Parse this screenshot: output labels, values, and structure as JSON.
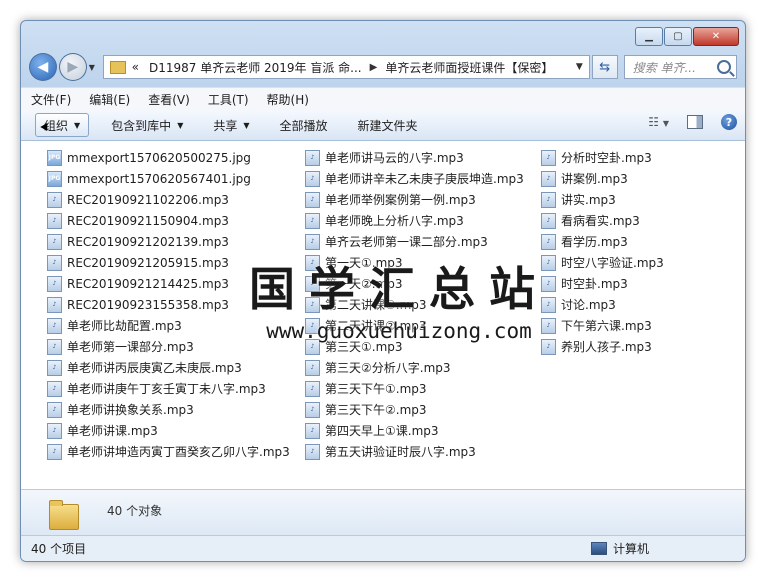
{
  "window": {
    "caption_buttons": [
      "▁",
      "▢",
      "✕"
    ]
  },
  "nav": {
    "back_icon": "back-arrow-icon",
    "forward_icon": "forward-arrow-icon",
    "breadcrumb_prefix": "«",
    "breadcrumb": [
      "D11987 单齐云老师 2019年 盲派 命...",
      "单齐云老师面授班课件【保密】"
    ],
    "search_placeholder": "搜索 单齐..."
  },
  "menu": [
    "文件(F)",
    "编辑(E)",
    "查看(V)",
    "工具(T)",
    "帮助(H)"
  ],
  "toolbar": {
    "organize": "组织",
    "include_library": "包含到库中",
    "share": "共享",
    "play_all": "全部播放",
    "new_folder": "新建文件夹"
  },
  "files": {
    "col1": [
      {
        "name": "mmexport1570620500275.jpg",
        "type": "jpg"
      },
      {
        "name": "mmexport1570620567401.jpg",
        "type": "jpg"
      },
      {
        "name": "REC20190921102206.mp3",
        "type": "mp3"
      },
      {
        "name": "REC20190921150904.mp3",
        "type": "mp3"
      },
      {
        "name": "REC20190921202139.mp3",
        "type": "mp3"
      },
      {
        "name": "REC20190921205915.mp3",
        "type": "mp3"
      },
      {
        "name": "REC20190921214425.mp3",
        "type": "mp3"
      },
      {
        "name": "REC20190923155358.mp3",
        "type": "mp3"
      },
      {
        "name": "单老师比劫配置.mp3",
        "type": "mp3"
      },
      {
        "name": "单老师第一课部分.mp3",
        "type": "mp3"
      },
      {
        "name": "单老师讲丙辰庚寅乙未庚辰.mp3",
        "type": "mp3"
      },
      {
        "name": "单老师讲庚午丁亥壬寅丁未八字.mp3",
        "type": "mp3"
      },
      {
        "name": "单老师讲换象关系.mp3",
        "type": "mp3"
      },
      {
        "name": "单老师讲课.mp3",
        "type": "mp3"
      },
      {
        "name": "单老师讲坤造丙寅丁酉癸亥乙卯八字.mp3",
        "type": "mp3"
      }
    ],
    "col2": [
      {
        "name": "单老师讲马云的八字.mp3",
        "type": "mp3"
      },
      {
        "name": "单老师讲辛未乙未庚子庚辰坤造.mp3",
        "type": "mp3"
      },
      {
        "name": "单老师举例案例第一例.mp3",
        "type": "mp3"
      },
      {
        "name": "单老师晚上分析八字.mp3",
        "type": "mp3"
      },
      {
        "name": "单齐云老师第一课二部分.mp3",
        "type": "mp3"
      },
      {
        "name": "第一天①.mp3",
        "type": "mp3"
      },
      {
        "name": "第一天②.mp3",
        "type": "mp3"
      },
      {
        "name": "第二天讲课①.mp3",
        "type": "mp3"
      },
      {
        "name": "第二天讲课②.mp3",
        "type": "mp3"
      },
      {
        "name": "第三天①.mp3",
        "type": "mp3"
      },
      {
        "name": "第三天②分析八字.mp3",
        "type": "mp3"
      },
      {
        "name": "第三天下午①.mp3",
        "type": "mp3"
      },
      {
        "name": "第三天下午②.mp3",
        "type": "mp3"
      },
      {
        "name": "第四天早上①课.mp3",
        "type": "mp3"
      },
      {
        "name": "第五天讲验证时辰八字.mp3",
        "type": "mp3"
      }
    ],
    "col3": [
      {
        "name": "分析时空卦.mp3",
        "type": "mp3"
      },
      {
        "name": "讲案例.mp3",
        "type": "mp3"
      },
      {
        "name": "讲实.mp3",
        "type": "mp3"
      },
      {
        "name": "看病看实.mp3",
        "type": "mp3"
      },
      {
        "name": "看学历.mp3",
        "type": "mp3"
      },
      {
        "name": "时空八字验证.mp3",
        "type": "mp3"
      },
      {
        "name": "时空卦.mp3",
        "type": "mp3"
      },
      {
        "name": "讨论.mp3",
        "type": "mp3"
      },
      {
        "name": "下午第六课.mp3",
        "type": "mp3"
      },
      {
        "name": "养别人孩子.mp3",
        "type": "mp3"
      }
    ]
  },
  "watermark": {
    "title": "国学汇总站",
    "url": "www.guoxuehuizong.com"
  },
  "details": {
    "object_count": "40 个对象"
  },
  "status": {
    "items": "40 个项目",
    "location": "计算机"
  }
}
